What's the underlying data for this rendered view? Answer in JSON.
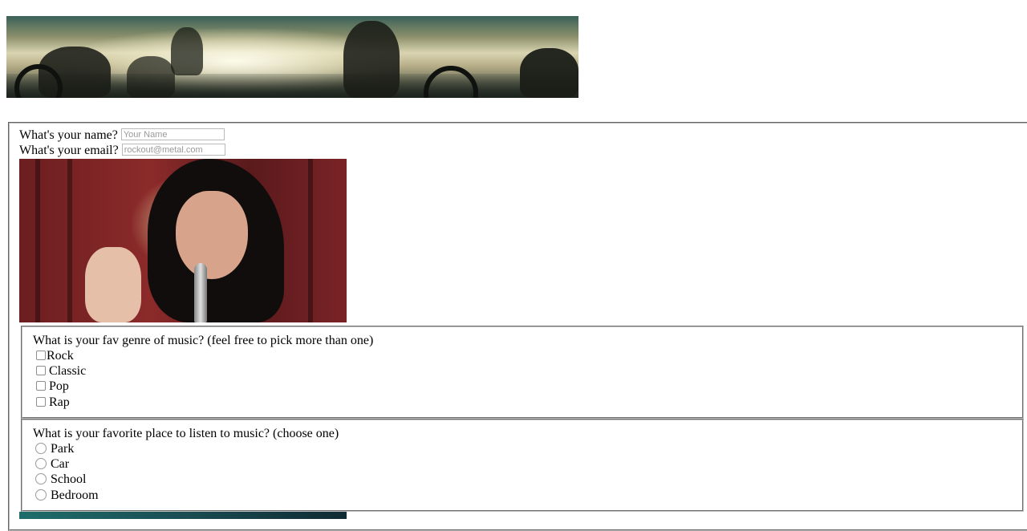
{
  "banner": {
    "description_icon": "motorcycle-riders-image"
  },
  "form": {
    "name_question": "What's your name?",
    "name_placeholder": "Your Name",
    "email_question": "What's your email?",
    "email_placeholder": "rockout@metal.com",
    "singer_image_icon": "singer-photo"
  },
  "genre": {
    "question": "What is your fav genre of music? (feel free to pick more than one)",
    "options": [
      "Rock",
      "Classic",
      "Pop",
      "Rap"
    ]
  },
  "place": {
    "question": "What is your favorite place to listen to music? (choose one)",
    "options": [
      "Park",
      "Car",
      "School",
      "Bedroom"
    ]
  }
}
